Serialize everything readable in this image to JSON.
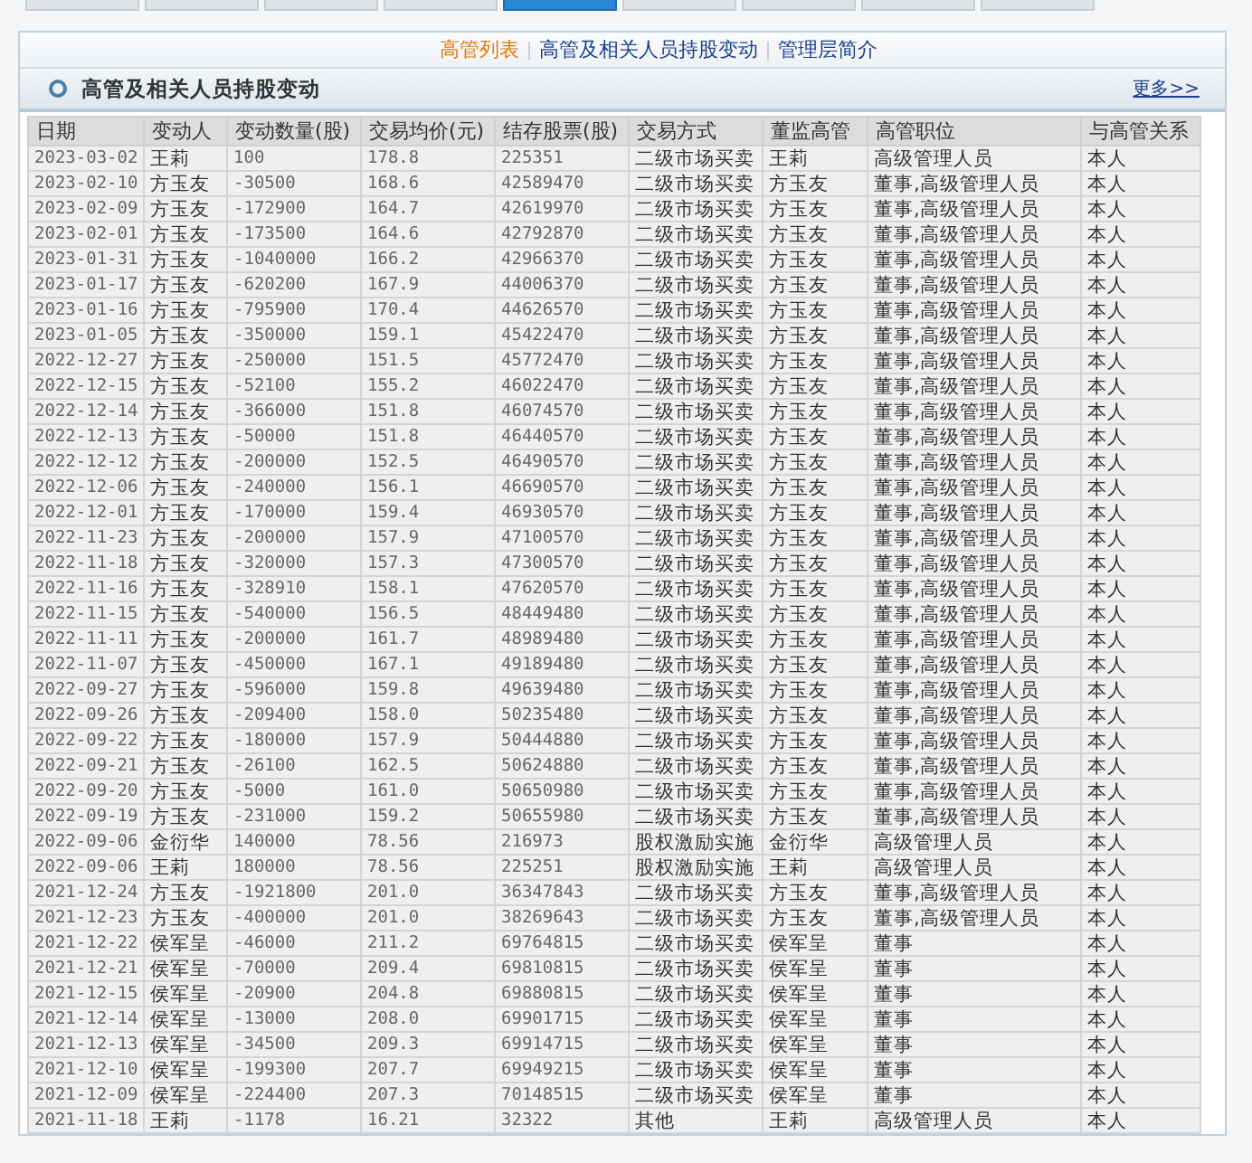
{
  "top_tabs": [
    {
      "selected": false
    },
    {
      "selected": false
    },
    {
      "selected": false
    },
    {
      "selected": false
    },
    {
      "selected": true
    },
    {
      "selected": false
    },
    {
      "selected": false
    },
    {
      "selected": false
    },
    {
      "selected": false
    }
  ],
  "nav_links": [
    {
      "label": "高管列表",
      "selected": true
    },
    {
      "label": "高管及相关人员持股变动",
      "selected": false
    },
    {
      "label": "管理层简介",
      "selected": false
    }
  ],
  "section": {
    "title": "高管及相关人员持股变动",
    "more_link": "更多>>"
  },
  "table": {
    "columns": [
      "日期",
      "变动人",
      "变动数量(股)",
      "交易均价(元)",
      "结存股票(股)",
      "交易方式",
      "董监高管",
      "高管职位",
      "与高管关系"
    ],
    "rows": [
      [
        "2023-03-02",
        "王莉",
        "100",
        "178.8",
        "225351",
        "二级市场买卖",
        "王莉",
        "高级管理人员",
        "本人"
      ],
      [
        "2023-02-10",
        "方玉友",
        "-30500",
        "168.6",
        "42589470",
        "二级市场买卖",
        "方玉友",
        "董事,高级管理人员",
        "本人"
      ],
      [
        "2023-02-09",
        "方玉友",
        "-172900",
        "164.7",
        "42619970",
        "二级市场买卖",
        "方玉友",
        "董事,高级管理人员",
        "本人"
      ],
      [
        "2023-02-01",
        "方玉友",
        "-173500",
        "164.6",
        "42792870",
        "二级市场买卖",
        "方玉友",
        "董事,高级管理人员",
        "本人"
      ],
      [
        "2023-01-31",
        "方玉友",
        "-1040000",
        "166.2",
        "42966370",
        "二级市场买卖",
        "方玉友",
        "董事,高级管理人员",
        "本人"
      ],
      [
        "2023-01-17",
        "方玉友",
        "-620200",
        "167.9",
        "44006370",
        "二级市场买卖",
        "方玉友",
        "董事,高级管理人员",
        "本人"
      ],
      [
        "2023-01-16",
        "方玉友",
        "-795900",
        "170.4",
        "44626570",
        "二级市场买卖",
        "方玉友",
        "董事,高级管理人员",
        "本人"
      ],
      [
        "2023-01-05",
        "方玉友",
        "-350000",
        "159.1",
        "45422470",
        "二级市场买卖",
        "方玉友",
        "董事,高级管理人员",
        "本人"
      ],
      [
        "2022-12-27",
        "方玉友",
        "-250000",
        "151.5",
        "45772470",
        "二级市场买卖",
        "方玉友",
        "董事,高级管理人员",
        "本人"
      ],
      [
        "2022-12-15",
        "方玉友",
        "-52100",
        "155.2",
        "46022470",
        "二级市场买卖",
        "方玉友",
        "董事,高级管理人员",
        "本人"
      ],
      [
        "2022-12-14",
        "方玉友",
        "-366000",
        "151.8",
        "46074570",
        "二级市场买卖",
        "方玉友",
        "董事,高级管理人员",
        "本人"
      ],
      [
        "2022-12-13",
        "方玉友",
        "-50000",
        "151.8",
        "46440570",
        "二级市场买卖",
        "方玉友",
        "董事,高级管理人员",
        "本人"
      ],
      [
        "2022-12-12",
        "方玉友",
        "-200000",
        "152.5",
        "46490570",
        "二级市场买卖",
        "方玉友",
        "董事,高级管理人员",
        "本人"
      ],
      [
        "2022-12-06",
        "方玉友",
        "-240000",
        "156.1",
        "46690570",
        "二级市场买卖",
        "方玉友",
        "董事,高级管理人员",
        "本人"
      ],
      [
        "2022-12-01",
        "方玉友",
        "-170000",
        "159.4",
        "46930570",
        "二级市场买卖",
        "方玉友",
        "董事,高级管理人员",
        "本人"
      ],
      [
        "2022-11-23",
        "方玉友",
        "-200000",
        "157.9",
        "47100570",
        "二级市场买卖",
        "方玉友",
        "董事,高级管理人员",
        "本人"
      ],
      [
        "2022-11-18",
        "方玉友",
        "-320000",
        "157.3",
        "47300570",
        "二级市场买卖",
        "方玉友",
        "董事,高级管理人员",
        "本人"
      ],
      [
        "2022-11-16",
        "方玉友",
        "-328910",
        "158.1",
        "47620570",
        "二级市场买卖",
        "方玉友",
        "董事,高级管理人员",
        "本人"
      ],
      [
        "2022-11-15",
        "方玉友",
        "-540000",
        "156.5",
        "48449480",
        "二级市场买卖",
        "方玉友",
        "董事,高级管理人员",
        "本人"
      ],
      [
        "2022-11-11",
        "方玉友",
        "-200000",
        "161.7",
        "48989480",
        "二级市场买卖",
        "方玉友",
        "董事,高级管理人员",
        "本人"
      ],
      [
        "2022-11-07",
        "方玉友",
        "-450000",
        "167.1",
        "49189480",
        "二级市场买卖",
        "方玉友",
        "董事,高级管理人员",
        "本人"
      ],
      [
        "2022-09-27",
        "方玉友",
        "-596000",
        "159.8",
        "49639480",
        "二级市场买卖",
        "方玉友",
        "董事,高级管理人员",
        "本人"
      ],
      [
        "2022-09-26",
        "方玉友",
        "-209400",
        "158.0",
        "50235480",
        "二级市场买卖",
        "方玉友",
        "董事,高级管理人员",
        "本人"
      ],
      [
        "2022-09-22",
        "方玉友",
        "-180000",
        "157.9",
        "50444880",
        "二级市场买卖",
        "方玉友",
        "董事,高级管理人员",
        "本人"
      ],
      [
        "2022-09-21",
        "方玉友",
        "-26100",
        "162.5",
        "50624880",
        "二级市场买卖",
        "方玉友",
        "董事,高级管理人员",
        "本人"
      ],
      [
        "2022-09-20",
        "方玉友",
        "-5000",
        "161.0",
        "50650980",
        "二级市场买卖",
        "方玉友",
        "董事,高级管理人员",
        "本人"
      ],
      [
        "2022-09-19",
        "方玉友",
        "-231000",
        "159.2",
        "50655980",
        "二级市场买卖",
        "方玉友",
        "董事,高级管理人员",
        "本人"
      ],
      [
        "2022-09-06",
        "金衍华",
        "140000",
        "78.56",
        "216973",
        "股权激励实施",
        "金衍华",
        "高级管理人员",
        "本人"
      ],
      [
        "2022-09-06",
        "王莉",
        "180000",
        "78.56",
        "225251",
        "股权激励实施",
        "王莉",
        "高级管理人员",
        "本人"
      ],
      [
        "2021-12-24",
        "方玉友",
        "-1921800",
        "201.0",
        "36347843",
        "二级市场买卖",
        "方玉友",
        "董事,高级管理人员",
        "本人"
      ],
      [
        "2021-12-23",
        "方玉友",
        "-400000",
        "201.0",
        "38269643",
        "二级市场买卖",
        "方玉友",
        "董事,高级管理人员",
        "本人"
      ],
      [
        "2021-12-22",
        "侯军呈",
        "-46000",
        "211.2",
        "69764815",
        "二级市场买卖",
        "侯军呈",
        "董事",
        "本人"
      ],
      [
        "2021-12-21",
        "侯军呈",
        "-70000",
        "209.4",
        "69810815",
        "二级市场买卖",
        "侯军呈",
        "董事",
        "本人"
      ],
      [
        "2021-12-15",
        "侯军呈",
        "-20900",
        "204.8",
        "69880815",
        "二级市场买卖",
        "侯军呈",
        "董事",
        "本人"
      ],
      [
        "2021-12-14",
        "侯军呈",
        "-13000",
        "208.0",
        "69901715",
        "二级市场买卖",
        "侯军呈",
        "董事",
        "本人"
      ],
      [
        "2021-12-13",
        "侯军呈",
        "-34500",
        "209.3",
        "69914715",
        "二级市场买卖",
        "侯军呈",
        "董事",
        "本人"
      ],
      [
        "2021-12-10",
        "侯军呈",
        "-199300",
        "207.7",
        "69949215",
        "二级市场买卖",
        "侯军呈",
        "董事",
        "本人"
      ],
      [
        "2021-12-09",
        "侯军呈",
        "-224400",
        "207.3",
        "70148515",
        "二级市场买卖",
        "侯军呈",
        "董事",
        "本人"
      ],
      [
        "2021-11-18",
        "王莉",
        "-1178",
        "16.21",
        "32322",
        "其他",
        "王莉",
        "高级管理人员",
        "本人"
      ]
    ]
  }
}
